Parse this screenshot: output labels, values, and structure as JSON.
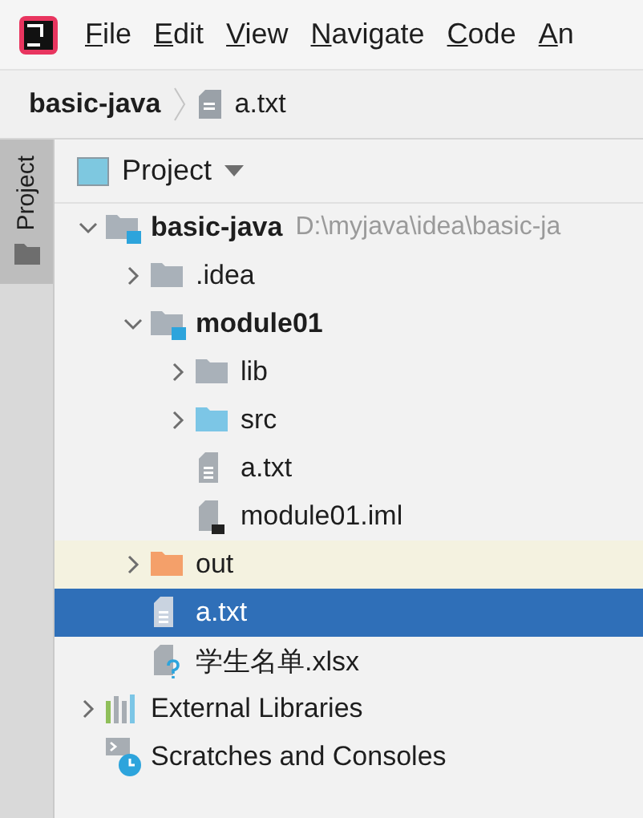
{
  "menu_bar": {
    "items": [
      {
        "label": "File",
        "mnemonic_underlined": true
      },
      {
        "label": "Edit",
        "mnemonic_underlined": true
      },
      {
        "label": "View",
        "mnemonic_underlined": true
      },
      {
        "label": "Navigate",
        "mnemonic_underlined": true
      },
      {
        "label": "Code",
        "mnemonic_underlined": true
      },
      {
        "label": "An",
        "mnemonic_underlined": true
      }
    ]
  },
  "breadcrumbs": [
    {
      "label": "basic-java",
      "kind": "project"
    },
    {
      "label": "a.txt",
      "kind": "text-file"
    }
  ],
  "side_tabs": [
    {
      "label": "Project",
      "selected": true
    }
  ],
  "panel": {
    "title": "Project"
  },
  "tree": [
    {
      "label": "basic-java",
      "kind": "module",
      "path": "D:\\myjava\\idea\\basic-ja",
      "expanded": true,
      "selected": false,
      "children": [
        {
          "label": ".idea",
          "kind": "folder",
          "expanded": false,
          "selected": false
        },
        {
          "label": "module01",
          "kind": "module",
          "expanded": true,
          "selected": false,
          "children": [
            {
              "label": "lib",
              "kind": "folder",
              "expanded": false,
              "selected": false
            },
            {
              "label": "src",
              "kind": "source-folder",
              "expanded": false,
              "selected": false
            },
            {
              "label": "a.txt",
              "kind": "text-file",
              "selected": false
            },
            {
              "label": "module01.iml",
              "kind": "iml-file",
              "selected": false
            }
          ]
        },
        {
          "label": "out",
          "kind": "excluded-folder",
          "expanded": false,
          "selected": false
        },
        {
          "label": "a.txt",
          "kind": "text-file",
          "selected": true
        },
        {
          "label": "学生名单.xlsx",
          "kind": "unknown-file",
          "selected": false
        }
      ]
    },
    {
      "label": "External Libraries",
      "kind": "libraries",
      "expanded": false,
      "selected": false
    },
    {
      "label": "Scratches and Consoles",
      "kind": "scratches",
      "selected": false
    }
  ]
}
